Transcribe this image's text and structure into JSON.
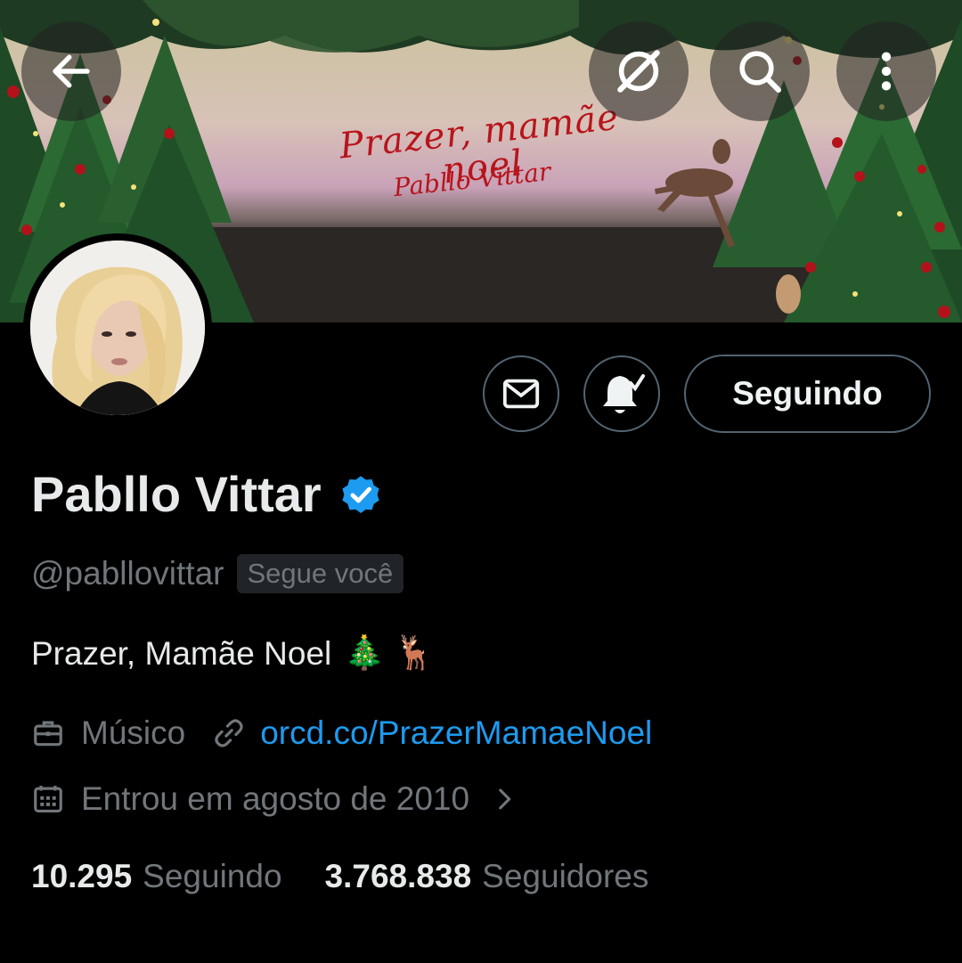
{
  "banner": {
    "title": "Prazer, mamãe noel",
    "subtitle": "Pabllo Vittar"
  },
  "header": {
    "back_icon": "arrow-left-icon",
    "grok_icon": "slashed-circle-icon",
    "search_icon": "search-icon",
    "more_icon": "more-vertical-icon"
  },
  "actions": {
    "message_icon": "envelope-icon",
    "notify_icon": "bell-check-icon",
    "follow_label": "Seguindo"
  },
  "profile": {
    "name": "Pabllo Vittar",
    "handle": "@pabllovittar",
    "follows_you": "Segue você",
    "bio": "Prazer, Mamãe Noel",
    "bio_emoji_1": "🎄",
    "bio_emoji_2": "🦌",
    "profession": "Músico",
    "link": "orcd.co/PrazerMamaeNoel",
    "joined": "Entrou em agosto de 2010",
    "following_count": "10.295",
    "following_label": "Seguindo",
    "followers_count": "3.768.838",
    "followers_label": "Seguidores"
  },
  "colors": {
    "background": "#000000",
    "text_primary": "#e7e9ea",
    "text_secondary": "#71767b",
    "link": "#1d9bf0",
    "verified": "#1d9bf0",
    "border": "#536471"
  }
}
